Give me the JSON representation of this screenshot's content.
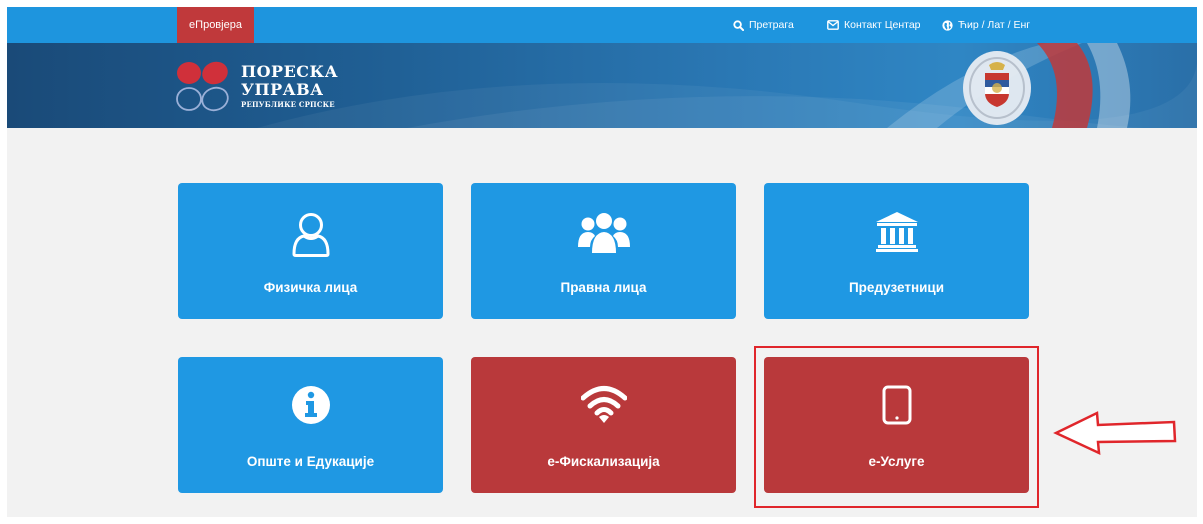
{
  "topbar": {
    "eprovjera_label": "еПровјера",
    "search_label": "Претрага",
    "contact_label": "Контакт Центар",
    "language_label": "Ћир / Лат / Енг"
  },
  "header": {
    "logo_line1": "ПОРЕСКА",
    "logo_line2": "УПРАВА",
    "logo_line3": "РЕПУБЛИКЕ СРПСКЕ"
  },
  "tiles": [
    {
      "label": "Физичка лица",
      "icon": "user-icon"
    },
    {
      "label": "Правна лица",
      "icon": "users-icon"
    },
    {
      "label": "Предузетници",
      "icon": "institution-icon"
    },
    {
      "label": "Опште и Едукације",
      "icon": "info-icon"
    },
    {
      "label": "е-Фискализација",
      "icon": "wifi-icon"
    },
    {
      "label": "е-Услуге",
      "icon": "tablet-icon"
    }
  ],
  "colors": {
    "topbar": "#1e95de",
    "tile_blue": "#1f98e3",
    "tile_red": "#b9393b",
    "annotation": "#e0262b"
  }
}
